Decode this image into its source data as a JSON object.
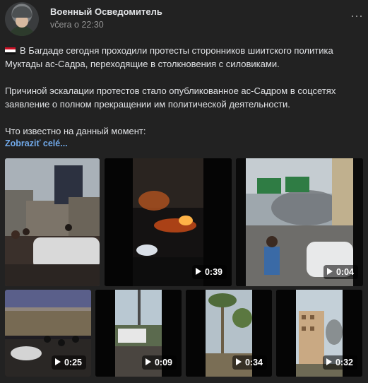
{
  "post": {
    "author": "Военный Осведомитель",
    "time": "včera o 22:30",
    "paragraph1": "В Багдаде сегодня проходили протесты сторонников шиитского политика Муктады ас-Садра, переходящие в столкновения с силовиками.",
    "paragraph2": "Причиной эскалации протестов стало опубликованное ас-Садром в соцсетях заявление о полном прекращении им политической деятельности.",
    "paragraph3": "Что известно на данный момент:",
    "show_more": "Zobraziť celé...",
    "flag_icon": "iraq-flag-icon",
    "more_icon": "more-dots-icon"
  },
  "media": [
    {
      "type": "photo",
      "name": "photo-crowd-baghdad"
    },
    {
      "type": "video",
      "duration": "0:39",
      "name": "video-fire-night"
    },
    {
      "type": "video",
      "duration": "0:04",
      "name": "video-smoke-road"
    },
    {
      "type": "video",
      "duration": "0:25",
      "name": "video-crowd-night"
    },
    {
      "type": "video",
      "duration": "0:09",
      "name": "video-truck-street"
    },
    {
      "type": "video",
      "duration": "0:34",
      "name": "video-palm-smoke"
    },
    {
      "type": "video",
      "duration": "0:32",
      "name": "video-building-smoke"
    }
  ],
  "colors": {
    "background": "#222222",
    "link": "#71aaeb",
    "text": "#e1e3e6",
    "muted": "#939393"
  }
}
